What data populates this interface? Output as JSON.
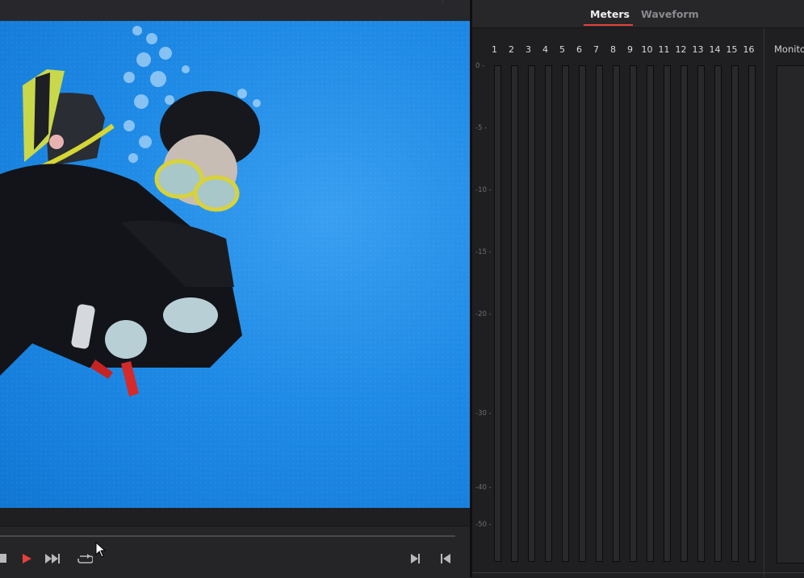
{
  "tabs": {
    "meters": "Meters",
    "waveform": "Waveform"
  },
  "channels": [
    "1",
    "2",
    "3",
    "4",
    "5",
    "6",
    "7",
    "8",
    "9",
    "10",
    "11",
    "12",
    "13",
    "14",
    "15",
    "16"
  ],
  "scale": [
    "0",
    "-5",
    "-10",
    "-15",
    "-20",
    "-30",
    "-40",
    "-50"
  ],
  "monitor": {
    "label": "Monito"
  },
  "colors": {
    "accent": "#e2433a",
    "play": "#e2433a",
    "water": "#1f8be6"
  },
  "icons": [
    "stop-icon",
    "play-icon",
    "fast-forward-icon",
    "loop-icon",
    "jump-to-end-icon",
    "jump-to-start-icon",
    "mouse-cursor-icon"
  ]
}
